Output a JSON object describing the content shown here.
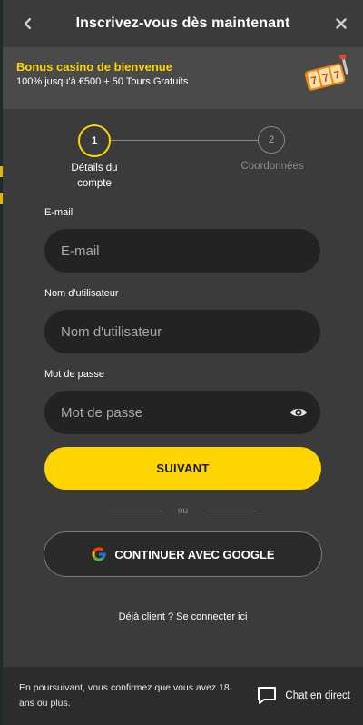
{
  "header": {
    "title": "Inscrivez-vous dès maintenant"
  },
  "bonus": {
    "title": "Bonus casino de bienvenue",
    "subtitle": "100% jusqu'à €500 + 50 Tours Gratuits"
  },
  "steps": [
    {
      "number": "1",
      "label": "Détails du compte",
      "active": true
    },
    {
      "number": "2",
      "label": "Coordonnées",
      "active": false
    }
  ],
  "form": {
    "email": {
      "label": "E-mail",
      "placeholder": "E-mail"
    },
    "username": {
      "label": "Nom d'utilisateur",
      "placeholder": "Nom d'utilisateur"
    },
    "password": {
      "label": "Mot de passe",
      "placeholder": "Mot de passe"
    },
    "submit_label": "SUIVANT",
    "or_label": "ou",
    "google_label": "CONTINUER AVEC GOOGLE"
  },
  "login": {
    "prompt": "Déjà client ?",
    "link": "Se connecter ici"
  },
  "footer": {
    "notice": "En poursuivant, vous confirmez que vous avez 18 ans ou plus.",
    "chat_label": "Chat en direct"
  },
  "colors": {
    "accent": "#ffd500",
    "background": "#3b3b3b",
    "input": "#232323"
  }
}
